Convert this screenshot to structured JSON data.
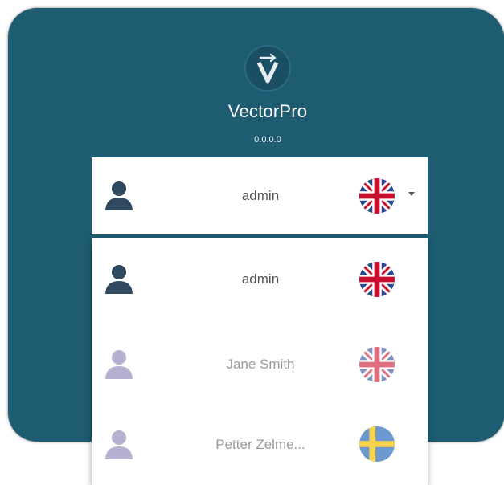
{
  "app": {
    "name": "VectorPro",
    "version": "0.0.0.0",
    "logo_icon": "vectorpro-logo-icon"
  },
  "colors": {
    "panel": "#1e5c72",
    "active_user": "#324a5f",
    "inactive_user": "#b7b0d0"
  },
  "selected_user": {
    "name": "admin",
    "language_flag": "uk-flag-icon"
  },
  "user_list": [
    {
      "name": "admin",
      "language_flag": "uk-flag-icon",
      "active": true
    },
    {
      "name": "Jane Smith",
      "language_flag": "uk-flag-icon",
      "active": false
    },
    {
      "name": "Petter Zelme...",
      "language_flag": "sweden-flag-icon",
      "active": false
    }
  ]
}
